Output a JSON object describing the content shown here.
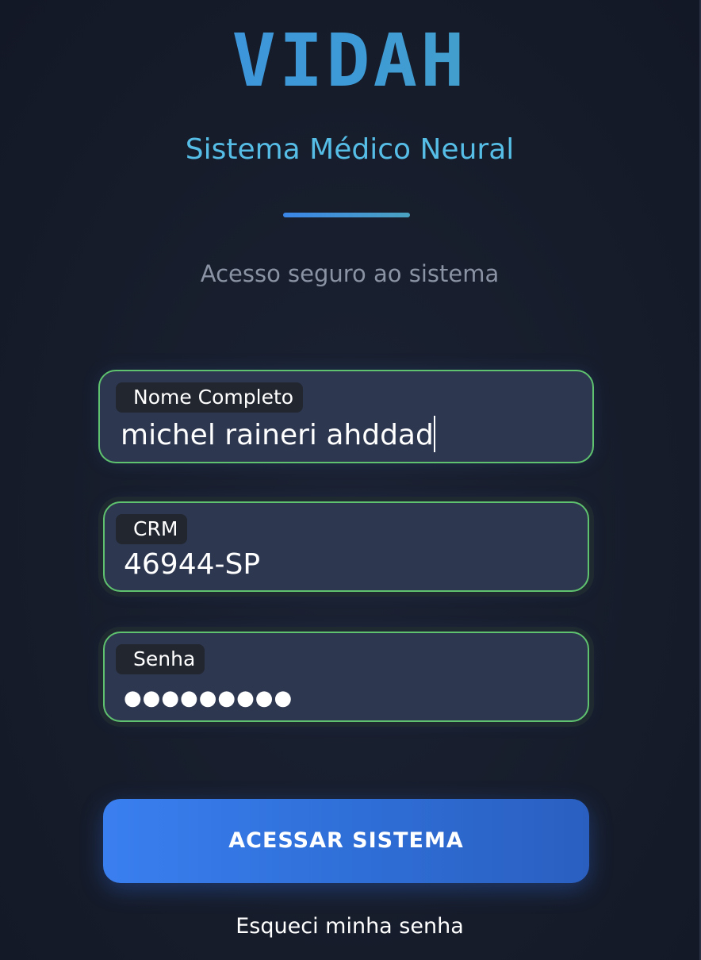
{
  "brand": {
    "logo_text": "VIDAH",
    "subtitle": "Sistema Médico Neural",
    "tagline": "Acesso seguro ao sistema"
  },
  "form": {
    "name": {
      "label": "Nome Completo",
      "value": "michel raineri ahddad"
    },
    "crm": {
      "label": "CRM",
      "value": "46944-SP"
    },
    "password": {
      "label": "Senha",
      "masked_value": "●●●●●●●●●"
    },
    "submit_label": "ACESSAR SISTEMA",
    "forgot_label": "Esqueci minha senha"
  },
  "colors": {
    "background": "#151b29",
    "field_background": "#2d3750",
    "field_border": "#5fc26e",
    "accent_blue": "#3a7ff0",
    "subtitle": "#56bde6"
  }
}
